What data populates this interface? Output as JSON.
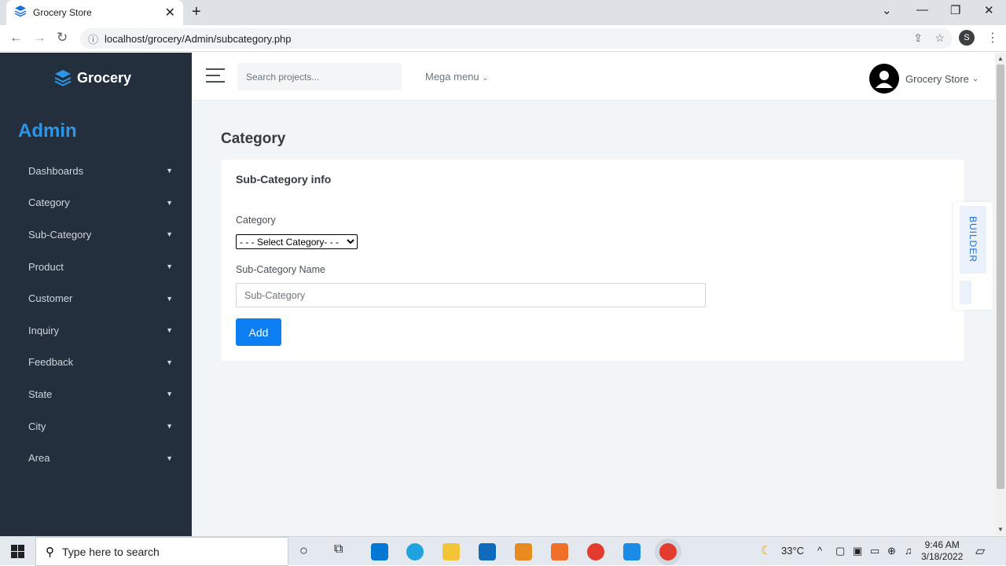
{
  "browser": {
    "tab_title": "Grocery Store",
    "tab_close": "✕",
    "new_tab": "+",
    "url": "localhost/grocery/Admin/subcategory.php",
    "profile_initial": "S"
  },
  "sidebar": {
    "brand": "Grocery",
    "role": "Admin",
    "items": [
      {
        "label": "Dashboards"
      },
      {
        "label": "Category"
      },
      {
        "label": "Sub-Category"
      },
      {
        "label": "Product"
      },
      {
        "label": "Customer"
      },
      {
        "label": "Inquiry"
      },
      {
        "label": "Feedback"
      },
      {
        "label": "State"
      },
      {
        "label": "City"
      },
      {
        "label": "Area"
      }
    ]
  },
  "topbar": {
    "search_placeholder": "Search projects...",
    "mega_menu": "Mega menu",
    "user_name": "Grocery Store"
  },
  "main": {
    "page_title": "Category",
    "card_title": "Sub-Category info",
    "category_label": "Category",
    "category_selected": "- - - Select Category- - -",
    "subcategory_label": "Sub-Category Name",
    "subcategory_placeholder": "Sub-Category",
    "add_button": "Add"
  },
  "builder": {
    "label": "BUILDER"
  },
  "taskbar": {
    "search_text": "Type here to search",
    "temperature": "33°C",
    "time": "9:46 AM",
    "date": "3/18/2022"
  },
  "colors": {
    "sidebar_bg": "#242f3d",
    "accent": "#0c7ff2",
    "admin_text": "#2b96e8",
    "content_bg": "#f2f5f8"
  }
}
